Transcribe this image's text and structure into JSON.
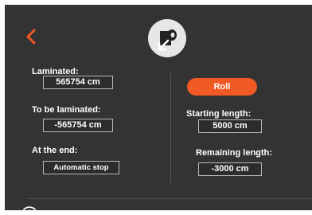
{
  "colors": {
    "accent": "#f15a24",
    "panel": "#333333"
  },
  "header": {
    "back_icon": "chevron-left-icon",
    "mode_icon": "roll-unwind-icon"
  },
  "left": {
    "laminated_label": "Laminated:",
    "laminated_value": "565754 cm",
    "to_be_laminated_label": "To be laminated:",
    "to_be_laminated_value": "-565754 cm",
    "at_end_label": "At the end:",
    "at_end_value": "Automatic stop"
  },
  "right": {
    "roll_button_label": "Roll",
    "starting_length_label": "Starting length:",
    "starting_length_value": "5000 cm",
    "remaining_length_label": "Remaining length:",
    "remaining_length_value": "-3000 cm"
  },
  "footer": {
    "status_icon": "wifi-icon"
  }
}
